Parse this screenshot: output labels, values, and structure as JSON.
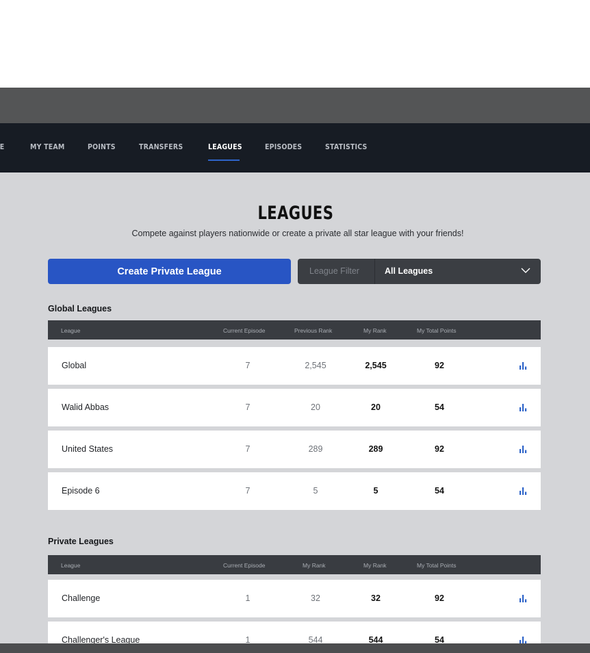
{
  "nav": {
    "partial_left": "IE",
    "items": [
      "MY TEAM",
      "POINTS",
      "TRANSFERS",
      "LEAGUES",
      "EPISODES",
      "STATISTICS"
    ],
    "active": "LEAGUES"
  },
  "header": {
    "title": "LEAGUES",
    "subtitle": "Compete against players nationwide or create a private all star league with your friends!"
  },
  "create_button": "Create Private League",
  "filter": {
    "label": "League Filter",
    "value": "All Leagues"
  },
  "global": {
    "title": "Global Leagues",
    "columns": [
      "League",
      "Current Episode",
      "Previous Rank",
      "My Rank",
      "My Total Points"
    ],
    "rows": [
      {
        "league": "Global",
        "episode": "7",
        "prev_rank": "2,545",
        "rank": "2,545",
        "points": "92"
      },
      {
        "league": "Walid Abbas",
        "episode": "7",
        "prev_rank": "20",
        "rank": "20",
        "points": "54"
      },
      {
        "league": "United States",
        "episode": "7",
        "prev_rank": "289",
        "rank": "289",
        "points": "92"
      },
      {
        "league": "Episode 6",
        "episode": "7",
        "prev_rank": "5",
        "rank": "5",
        "points": "54"
      }
    ]
  },
  "private": {
    "title": "Private Leagues",
    "columns": [
      "League",
      "Current Episode",
      "My Rank",
      "My Rank",
      "My Total Points"
    ],
    "rows": [
      {
        "league": "Challenge",
        "episode": "1",
        "prev_rank": "32",
        "rank": "32",
        "points": "92"
      },
      {
        "league": "Challenger's League",
        "episode": "1",
        "prev_rank": "544",
        "rank": "544",
        "points": "54"
      }
    ]
  },
  "icons": {
    "stats": "bar-chart-icon",
    "dropdown": "chevron-down-icon"
  },
  "colors": {
    "nav_bg": "#171c24",
    "accent_blue": "#2855c4",
    "content_bg": "#d4d5d8",
    "table_header_bg": "#393c41",
    "icon_blue": "#2e64c9"
  }
}
